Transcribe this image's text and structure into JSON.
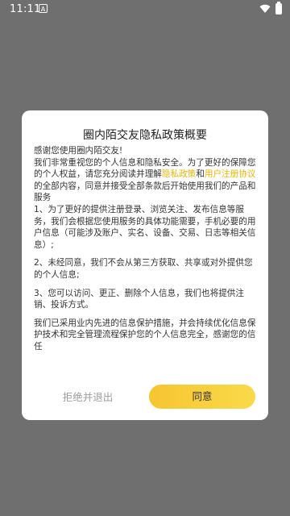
{
  "status_bar": {
    "time": "11:11",
    "notification_icon": "A",
    "icons": [
      "wifi-icon",
      "battery-icon"
    ]
  },
  "dialog": {
    "title": "圈内陌交友隐私政策概要",
    "greeting": "感谢您使用圈内陌交友!",
    "para1_a": "我们非常重视您的个人信息和隐私安全。为了更好的保障您的个人权益，请您充分阅读并理解",
    "privacy_link": "隐私政策",
    "and": "和",
    "agreement_link": "用户注册协议",
    "para1_b": "的全部内容，同意并接受全部条款后开始使用我们的产品和服务",
    "item1": "1、为了更好的提供注册登录、浏览关注、发布信息等服务，我们会根据您使用服务的具体功能需要，手机必要的用户信息（可能涉及账户、实名、设备、交易、日志等相关信息）;",
    "item2": "2、未经同意，我们不会从第三方获取、共享或对外提供您的个人信息;",
    "item3": "3、您可以访问、更正、删除个人信息，我们也将提供注销、投诉方式。",
    "closing": "我们已采用业内先进的信息保护措施，并会持续优化信息保护技术和完全管理流程保护您的个人信息完全，感谢您的信任",
    "decline_label": "拒绝并退出",
    "agree_label": "同意"
  },
  "colors": {
    "overlay": "#6f6f6f",
    "link": "#f1b400",
    "button_gradient_start": "#f7c531",
    "button_gradient_end": "#f9da4a",
    "decline_text": "#9e9e9e"
  }
}
